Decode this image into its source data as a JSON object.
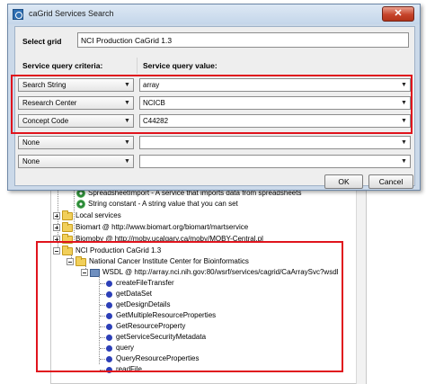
{
  "dialog": {
    "title": "caGrid Services Search",
    "close_glyph": "✕",
    "select_grid_label": "Select grid",
    "grid_value": "NCI Production CaGrid 1.3",
    "criteria_header": "Service query criteria:",
    "value_header": "Service query value:",
    "rows": [
      {
        "criteria": "Search String",
        "value": "array"
      },
      {
        "criteria": "Research Center",
        "value": "NCICB"
      },
      {
        "criteria": "Concept Code",
        "value": "C44282"
      },
      {
        "criteria": "None",
        "value": ""
      },
      {
        "criteria": "None",
        "value": ""
      }
    ],
    "ok_label": "OK",
    "cancel_label": "Cancel"
  },
  "tree": {
    "spreadsheet_import": "SpreadsheetImport - A service that imports data from spreadsheets",
    "string_constant": "String constant - A string value that you can set",
    "local_services": "Local services",
    "biomart": "Biomart @ http://www.biomart.org/biomart/martservice",
    "biomoby": "Biomoby @ http://moby.ucalgary.ca/moby/MOBY-Central.pl",
    "nci_production": "NCI Production CaGrid 1.3",
    "nci_center": "National Cancer Institute Center for Bioinformatics",
    "wsdl": "WSDL @ http://array.nci.nih.gov:80/wsrf/services/cagrid/CaArraySvc?wsdl",
    "operations": [
      "createFileTransfer",
      "getDataSet",
      "getDesignDetails",
      "GetMultipleResourceProperties",
      "GetResourceProperty",
      "getServiceSecurityMetadata",
      "query",
      "QueryResourceProperties",
      "readFile"
    ]
  },
  "colors": {
    "highlight": "#e0141d",
    "title_bar": "#c4d6ea",
    "close_button": "#c7442b",
    "operation_icon": "#2c3fb8"
  },
  "icons": {
    "service": "gear-icon",
    "folder": "folder-icon",
    "wsdl": "wsdl-icon",
    "operation": "operation-dot-icon",
    "dropdown": "chevron-down-icon"
  }
}
